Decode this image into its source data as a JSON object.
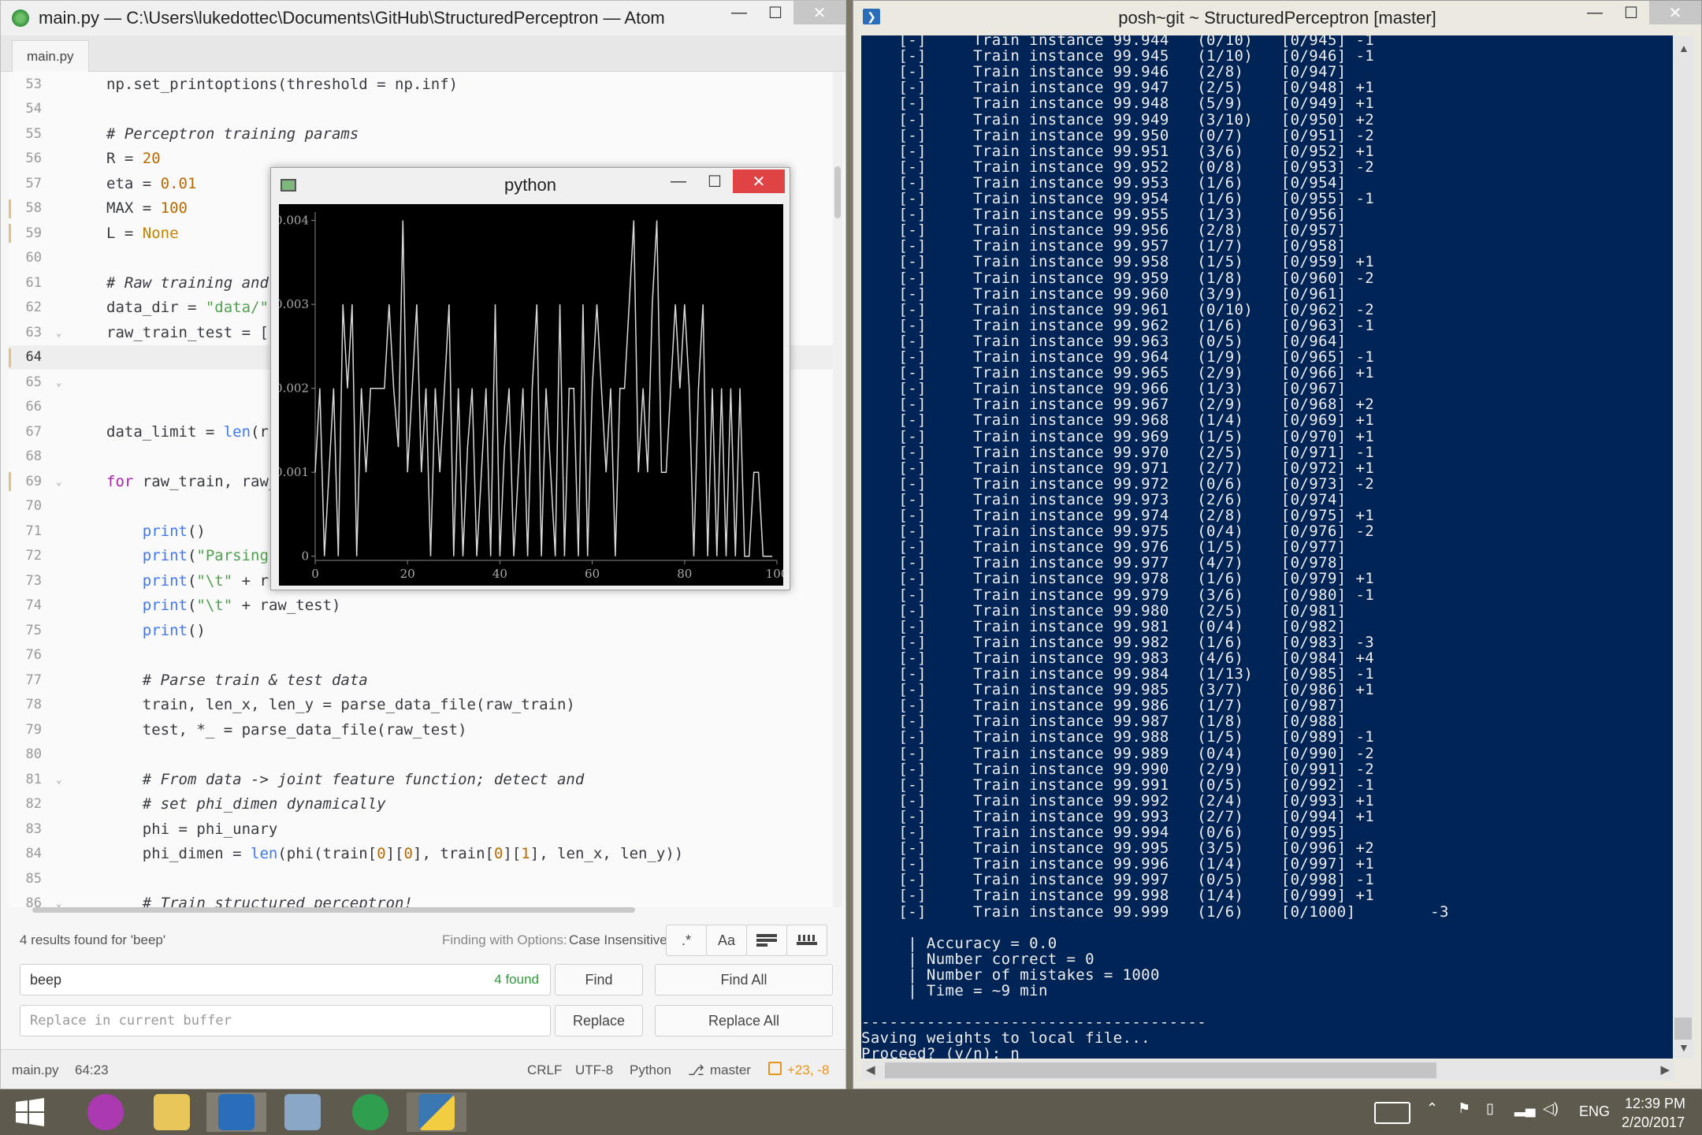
{
  "atom": {
    "title": "main.py — C:\\Users\\lukedottec\\Documents\\GitHub\\StructuredPerceptron — Atom",
    "tab": "main.py",
    "controls": {
      "minimize": "—",
      "maximize": "☐",
      "close": "✕"
    },
    "lines": [
      {
        "n": "53",
        "code": "np.set_printoptions(threshold = np.inf)"
      },
      {
        "n": "54",
        "code": ""
      },
      {
        "n": "55",
        "code": "# Perceptron training params"
      },
      {
        "n": "56",
        "code": "R = 20"
      },
      {
        "n": "57",
        "code": "eta = 0.01"
      },
      {
        "n": "58",
        "code": "MAX = 100"
      },
      {
        "n": "59",
        "code": "L = None"
      },
      {
        "n": "60",
        "code": ""
      },
      {
        "n": "61",
        "code": "# Raw training and"
      },
      {
        "n": "62",
        "code": "data_dir = \"data/\""
      },
      {
        "n": "63",
        "code": "raw_train_test = ["
      },
      {
        "n": "64",
        "code": ""
      },
      {
        "n": "65",
        "code": ""
      },
      {
        "n": "66",
        "code": ""
      },
      {
        "n": "67",
        "code": "data_limit = len(r"
      },
      {
        "n": "68",
        "code": ""
      },
      {
        "n": "69",
        "code": "for raw_train, raw_"
      },
      {
        "n": "70",
        "code": ""
      },
      {
        "n": "71",
        "code": "    print()"
      },
      {
        "n": "72",
        "code": "    print(\"Parsing"
      },
      {
        "n": "73",
        "code": "    print(\"\\t\" + r"
      },
      {
        "n": "74",
        "code": "    print(\"\\t\" + raw_test)"
      },
      {
        "n": "75",
        "code": "    print()"
      },
      {
        "n": "76",
        "code": ""
      },
      {
        "n": "77",
        "code": "    # Parse train & test data"
      },
      {
        "n": "78",
        "code": "    train, len_x, len_y = parse_data_file(raw_train)"
      },
      {
        "n": "79",
        "code": "    test, *_ = parse_data_file(raw_test)"
      },
      {
        "n": "80",
        "code": ""
      },
      {
        "n": "81",
        "code": "    # From data -> joint feature function; detect and"
      },
      {
        "n": "82",
        "code": "    # set phi_dimen dynamically"
      },
      {
        "n": "83",
        "code": "    phi = phi_unary"
      },
      {
        "n": "84",
        "code": "    phi_dimen = len(phi(train[0][0], train[0][1], len_x, len_y))"
      },
      {
        "n": "85",
        "code": ""
      },
      {
        "n": "86",
        "code": "    # Train structured perceptron!"
      }
    ],
    "find": {
      "results": "4 results found for 'beep'",
      "options_label": "Finding with Options:",
      "options_value": "Case Insensitive",
      "query": "beep",
      "found": "4 found",
      "replace_placeholder": "Replace in current buffer",
      "find": "Find",
      "find_all": "Find All",
      "replace": "Replace",
      "replace_all": "Replace All",
      "regex": ".*",
      "case": "Aa"
    },
    "status": {
      "file": "main.py",
      "pos": "64:23",
      "eol": "CRLF",
      "enc": "UTF-8",
      "grammar": "Python",
      "branch": "master",
      "diff": "+23, -8"
    }
  },
  "python_window": {
    "title": "python"
  },
  "chart_data": {
    "type": "line",
    "x": [
      0,
      1,
      2,
      3,
      4,
      5,
      6,
      7,
      8,
      9,
      10,
      11,
      12,
      13,
      14,
      15,
      16,
      17,
      18,
      19,
      20,
      21,
      22,
      23,
      24,
      25,
      26,
      27,
      28,
      29,
      30,
      31,
      32,
      33,
      34,
      35,
      36,
      37,
      38,
      39,
      40,
      41,
      42,
      43,
      44,
      45,
      46,
      47,
      48,
      49,
      50,
      51,
      52,
      53,
      54,
      55,
      56,
      57,
      58,
      59,
      60,
      61,
      62,
      63,
      64,
      65,
      66,
      67,
      68,
      69,
      70,
      71,
      72,
      73,
      74,
      75,
      76,
      77,
      78,
      79,
      80,
      81,
      82,
      83,
      84,
      85,
      86,
      87,
      88,
      89,
      90,
      91,
      92,
      93,
      94,
      95,
      96,
      97,
      98,
      99
    ],
    "y": [
      0.001,
      0.002,
      0,
      0.001,
      0.002,
      0,
      0.003,
      0.002,
      0.003,
      0,
      0.002,
      0.001,
      0.002,
      0.002,
      0.002,
      0.002,
      0.003,
      0.002,
      0.0013,
      0.004,
      0.001,
      0.002,
      0.003,
      0.001,
      0.002,
      0,
      0.002,
      0.001,
      0.002,
      0.003,
      0,
      0.002,
      0,
      0.0013,
      0.002,
      0,
      0.001,
      0.002,
      0,
      0.003,
      0,
      0.0013,
      0.002,
      0,
      0.001,
      0.002,
      0,
      0.002,
      0.003,
      0,
      0.002,
      0.001,
      0,
      0.003,
      0,
      0.002,
      0.002,
      0,
      0.003,
      0,
      0.002,
      0.003,
      0.002,
      0.001,
      0.002,
      0,
      0.002,
      0.002,
      0.003,
      0.004,
      0.001,
      0.002,
      0.001,
      0.003,
      0.004,
      0.001,
      0.001,
      0.002,
      0.003,
      0.002,
      0.003,
      0.002,
      0,
      0.002,
      0.003,
      0,
      0.002,
      0,
      0.002,
      0,
      0.002,
      0,
      0.002,
      0,
      0,
      0.001,
      0.001,
      0,
      0,
      0
    ],
    "yticks": [
      "0",
      "0.001",
      "0.002",
      "0.003",
      "0.004"
    ],
    "xticks": [
      "0",
      "20",
      "40",
      "60",
      "80",
      "100"
    ],
    "xlim": [
      0,
      100
    ],
    "ylim": [
      -5e-05,
      0.0041
    ],
    "line_color": "#d8d8d8",
    "background": "#000000"
  },
  "powershell": {
    "title": "posh~git ~ StructuredPerceptron [master]",
    "lines": [
      "    [-]     Train instance 99.944   (0/10)   [0/945] -1",
      "    [-]     Train instance 99.945   (1/10)   [0/946] -1",
      "    [-]     Train instance 99.946   (2/8)    [0/947]",
      "    [-]     Train instance 99.947   (2/5)    [0/948] +1",
      "    [-]     Train instance 99.948   (5/9)    [0/949] +1",
      "    [-]     Train instance 99.949   (3/10)   [0/950] +2",
      "    [-]     Train instance 99.950   (0/7)    [0/951] -2",
      "    [-]     Train instance 99.951   (3/6)    [0/952] +1",
      "    [-]     Train instance 99.952   (0/8)    [0/953] -2",
      "    [-]     Train instance 99.953   (1/6)    [0/954]",
      "    [-]     Train instance 99.954   (1/6)    [0/955] -1",
      "    [-]     Train instance 99.955   (1/3)    [0/956]",
      "    [-]     Train instance 99.956   (2/8)    [0/957]",
      "    [-]     Train instance 99.957   (1/7)    [0/958]",
      "    [-]     Train instance 99.958   (1/5)    [0/959] +1",
      "    [-]     Train instance 99.959   (1/8)    [0/960] -2",
      "    [-]     Train instance 99.960   (3/9)    [0/961]",
      "    [-]     Train instance 99.961   (0/10)   [0/962] -2",
      "    [-]     Train instance 99.962   (1/6)    [0/963] -1",
      "    [-]     Train instance 99.963   (0/5)    [0/964]",
      "    [-]     Train instance 99.964   (1/9)    [0/965] -1",
      "    [-]     Train instance 99.965   (2/9)    [0/966] +1",
      "    [-]     Train instance 99.966   (1/3)    [0/967]",
      "    [-]     Train instance 99.967   (2/9)    [0/968] +2",
      "    [-]     Train instance 99.968   (1/4)    [0/969] +1",
      "    [-]     Train instance 99.969   (1/5)    [0/970] +1",
      "    [-]     Train instance 99.970   (2/5)    [0/971] -1",
      "    [-]     Train instance 99.971   (2/7)    [0/972] +1",
      "    [-]     Train instance 99.972   (0/6)    [0/973] -2",
      "    [-]     Train instance 99.973   (2/6)    [0/974]",
      "    [-]     Train instance 99.974   (2/8)    [0/975] +1",
      "    [-]     Train instance 99.975   (0/4)    [0/976] -2",
      "    [-]     Train instance 99.976   (1/5)    [0/977]",
      "    [-]     Train instance 99.977   (4/7)    [0/978]",
      "    [-]     Train instance 99.978   (1/6)    [0/979] +1",
      "    [-]     Train instance 99.979   (3/6)    [0/980] -1",
      "    [-]     Train instance 99.980   (2/5)    [0/981]",
      "    [-]     Train instance 99.981   (0/4)    [0/982]",
      "    [-]     Train instance 99.982   (1/6)    [0/983] -3",
      "    [-]     Train instance 99.983   (4/6)    [0/984] +4",
      "    [-]     Train instance 99.984   (1/13)   [0/985] -1",
      "    [-]     Train instance 99.985   (3/7)    [0/986] +1",
      "    [-]     Train instance 99.986   (1/7)    [0/987]",
      "    [-]     Train instance 99.987   (1/8)    [0/988]",
      "    [-]     Train instance 99.988   (1/5)    [0/989] -1",
      "    [-]     Train instance 99.989   (0/4)    [0/990] -2",
      "    [-]     Train instance 99.990   (2/9)    [0/991] -2",
      "    [-]     Train instance 99.991   (0/5)    [0/992] -1",
      "    [-]     Train instance 99.992   (2/4)    [0/993] +1",
      "    [-]     Train instance 99.993   (2/7)    [0/994] +1",
      "    [-]     Train instance 99.994   (0/6)    [0/995]",
      "    [-]     Train instance 99.995   (3/5)    [0/996] +2",
      "    [-]     Train instance 99.996   (1/4)    [0/997] +1",
      "    [-]     Train instance 99.997   (0/5)    [0/998] -1",
      "    [-]     Train instance 99.998   (1/4)    [0/999] +1",
      "    [-]     Train instance 99.999   (1/6)    [0/1000]        -3",
      "",
      "     | Accuracy = 0.0",
      "     | Number correct = 0",
      "     | Number of mistakes = 1000",
      "     | Time = ~9 min",
      "",
      "-------------------------------------",
      "Saving weights to local file...",
      "Proceed? (y/n): n"
    ]
  },
  "taskbar": {
    "lang": "ENG",
    "time": "12:39 PM",
    "date": "2/20/2017"
  }
}
